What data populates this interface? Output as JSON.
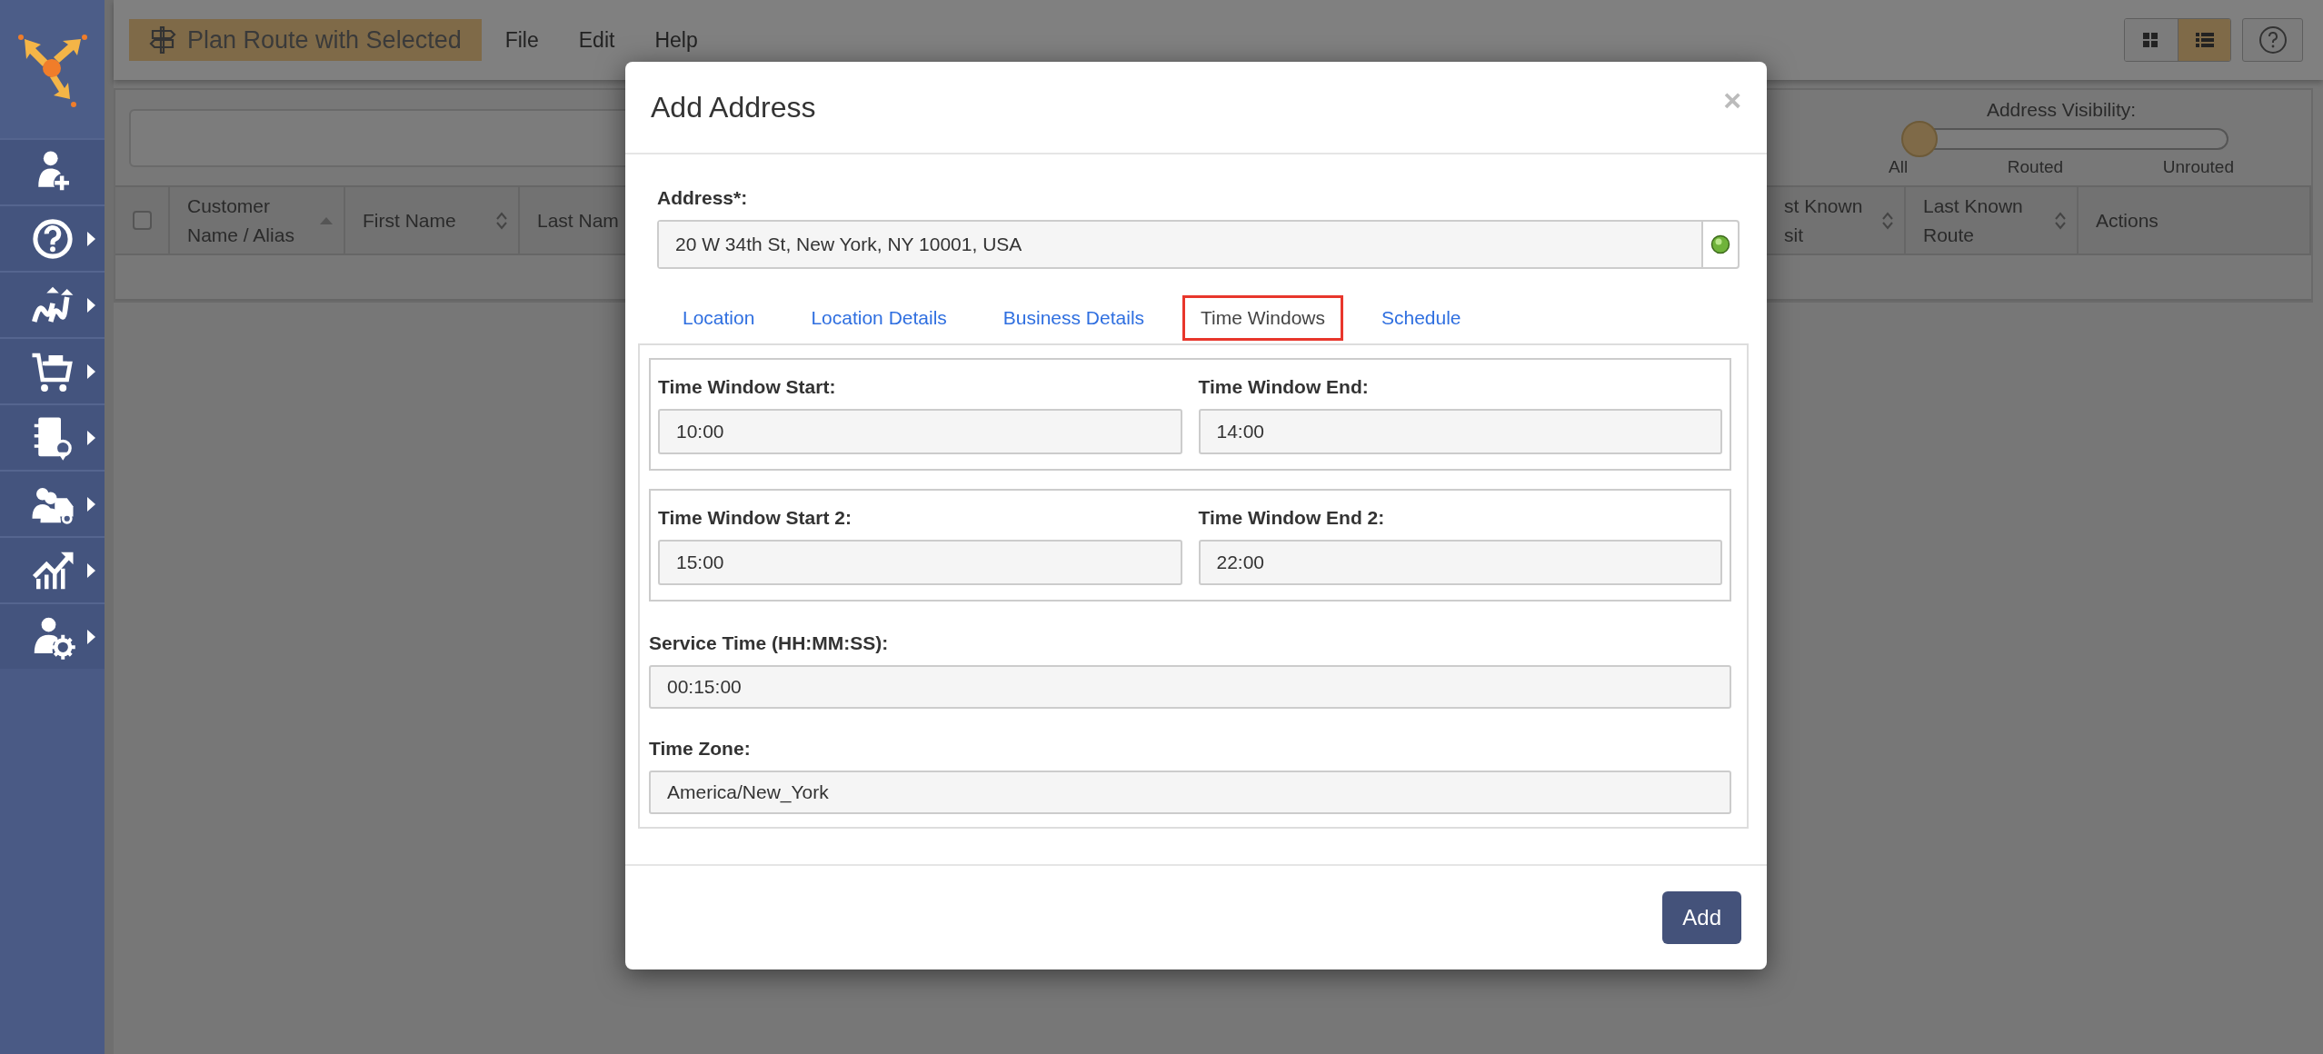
{
  "sidebar": {
    "items": [
      {
        "submenu": false
      },
      {
        "submenu": true
      },
      {
        "submenu": true
      },
      {
        "submenu": true
      },
      {
        "submenu": true
      },
      {
        "submenu": true
      },
      {
        "submenu": true
      },
      {
        "submenu": true
      }
    ]
  },
  "toolbar": {
    "primary_button": "Plan Route with Selected",
    "menu": [
      "File",
      "Edit",
      "Help"
    ]
  },
  "view_toggle": [
    {
      "selected": false
    },
    {
      "selected": true
    }
  ],
  "visibility": {
    "label": "Address Visibility:",
    "level": 0,
    "stops": [
      "All",
      "Routed",
      "Unrouted"
    ]
  },
  "table": {
    "select_all": {
      "checked": false
    },
    "left_columns": [
      {
        "label": "Customer Name / Alias",
        "sortable": true,
        "sorted": true
      },
      {
        "label": "First Name",
        "sortable": true,
        "sorted": false
      },
      {
        "label": "Last Nam",
        "sortable": false
      }
    ],
    "right_columns": [
      {
        "label": "st Known sit",
        "sortable": true,
        "sorted": false
      },
      {
        "label": "Last Known Route",
        "sortable": true,
        "sorted": false
      },
      {
        "label": "Actions",
        "sortable": false
      }
    ]
  },
  "modal": {
    "title": "Add Address",
    "close": "×",
    "address_label": "Address*:",
    "address_value": "20 W 34th St, New York, NY 10001, USA",
    "tabs": [
      {
        "label": "Location",
        "selected": false
      },
      {
        "label": "Location Details",
        "selected": false
      },
      {
        "label": "Business Details",
        "selected": false
      },
      {
        "label": "Time Windows",
        "selected": true
      },
      {
        "label": "Schedule",
        "selected": false
      }
    ],
    "time_windows": [
      {
        "start_label": "Time Window Start:",
        "start": "10:00",
        "end_label": "Time Window End:",
        "end": "14:00"
      },
      {
        "start_label": "Time Window Start 2:",
        "start": "15:00",
        "end_label": "Time Window End 2:",
        "end": "22:00"
      }
    ],
    "fields": [
      {
        "label": "Service Time (HH:MM:SS):",
        "value": "00:15:00"
      },
      {
        "label": "Time Zone:",
        "value": "America/New_York"
      }
    ],
    "submit": "Add"
  }
}
